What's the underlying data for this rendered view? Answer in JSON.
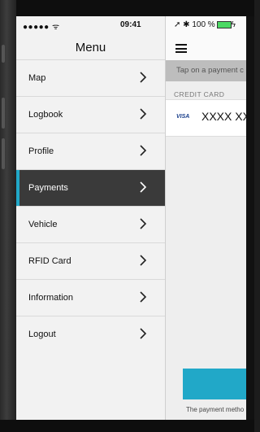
{
  "status_bar": {
    "signal": "●●●●● ᯤ",
    "time": "09:41",
    "right": "➚ ✱ 100 %"
  },
  "menu": {
    "title": "Menu",
    "items": [
      {
        "label": "Map"
      },
      {
        "label": "Logbook"
      },
      {
        "label": "Profile"
      },
      {
        "label": "Payments",
        "active": true
      },
      {
        "label": "Vehicle"
      },
      {
        "label": "RFID Card"
      },
      {
        "label": "Information"
      },
      {
        "label": "Logout"
      }
    ]
  },
  "payments": {
    "hint": "Tap on a payment c",
    "section_label": "CREDIT CARD",
    "card_brand": "VISA",
    "card_number": "XXXX XXX",
    "footer": "The payment metho"
  },
  "colors": {
    "accent": "#21a8c8",
    "active_bg": "#3a3a3a"
  }
}
